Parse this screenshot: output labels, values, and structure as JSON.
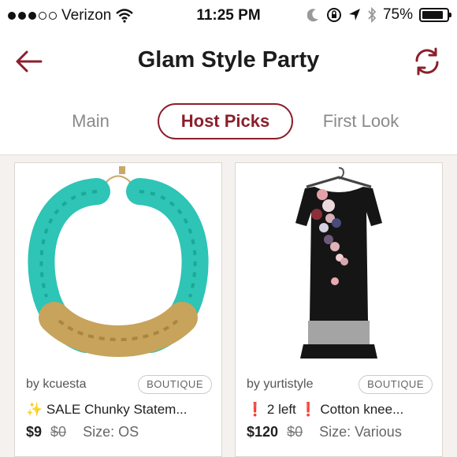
{
  "status_bar": {
    "carrier": "Verizon",
    "time": "11:25 PM",
    "battery": "75%"
  },
  "header": {
    "title": "Glam Style Party",
    "back_icon": "arrow-left-icon",
    "refresh_icon": "refresh-icon"
  },
  "tabs": [
    {
      "label": "Main",
      "active": false
    },
    {
      "label": "Host Picks",
      "active": true
    },
    {
      "label": "First Look",
      "active": false
    }
  ],
  "listings": [
    {
      "seller": "by kcuesta",
      "badge": "BOUTIQUE",
      "emoji_prefix": "✨",
      "title": "SALE Chunky Statem...",
      "price": "$9",
      "original_price": "$0",
      "size": "Size: OS"
    },
    {
      "seller": "by yurtistyle",
      "badge": "BOUTIQUE",
      "emoji_prefix": "❗",
      "title_part1": "2 left",
      "emoji_suffix": "❗",
      "title_part2": "Cotton knee...",
      "price": "$120",
      "original_price": "$0",
      "size": "Size: Various"
    }
  ],
  "colors": {
    "accent": "#8b1f2c",
    "background": "#f4f1ee"
  }
}
